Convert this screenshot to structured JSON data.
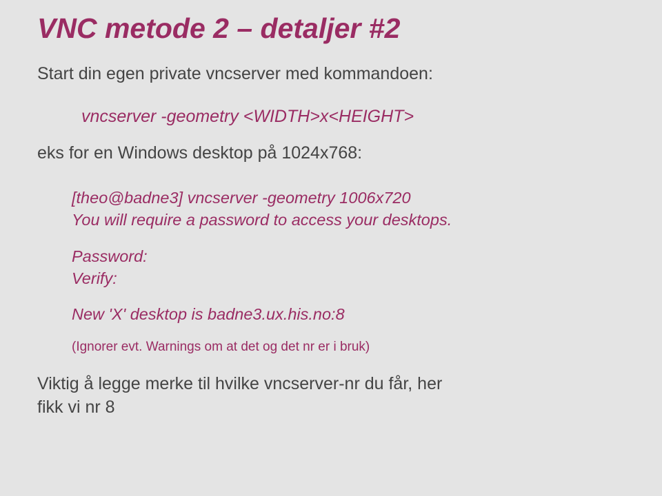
{
  "title": "VNC metode 2 – detaljer  #2",
  "intro": "Start din egen private vncserver med kommandoen:",
  "command": "vncserver -geometry <WIDTH>x<HEIGHT>",
  "eks": "eks for en Windows desktop på 1024x768:",
  "term_line1": "[theo@badne3] vncserver -geometry 1006x720",
  "term_line2": "You will require a password to access your desktops.",
  "term_password": "Password:",
  "term_verify": "Verify:",
  "term_new": "New 'X' desktop is badne3.ux.his.no:8",
  "note": "(Ignorer evt. Warnings om at det og det nr er i bruk)",
  "footer1": "Viktig å legge merke til hvilke vncserver-nr du får, her",
  "footer2": "fikk vi nr 8"
}
